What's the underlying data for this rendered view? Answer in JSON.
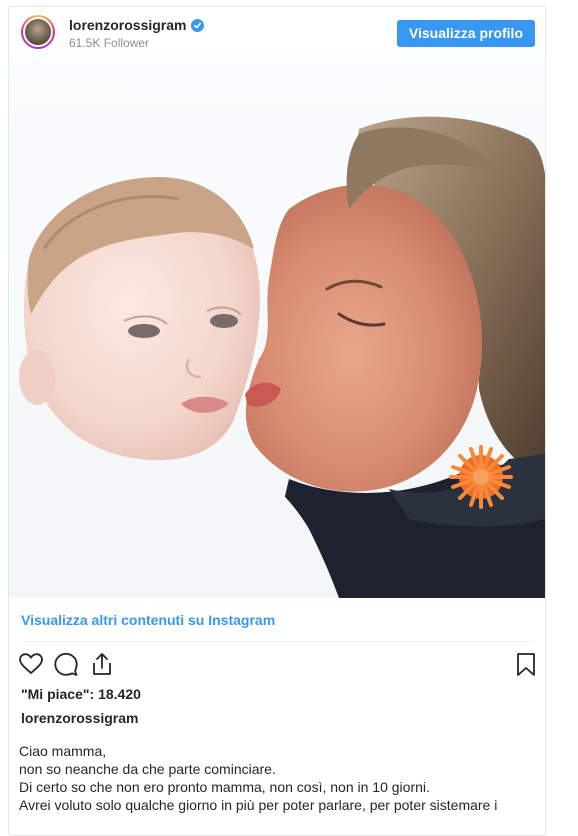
{
  "header": {
    "username": "lorenzorossigram",
    "followers": "61.5K Follower",
    "profile_button": "Visualizza profilo"
  },
  "icons": {
    "verified": "verified-badge-icon",
    "like": "heart-icon",
    "comment": "comment-icon",
    "share": "share-icon",
    "save": "bookmark-icon"
  },
  "colors": {
    "accent": "#3897f0",
    "text": "#262626",
    "muted": "#8e8e8e"
  },
  "more_link": "Visualizza altri contenuti su Instagram",
  "likes": "\"Mi piace\": 18.420",
  "author": "lorenzorossigram",
  "caption": {
    "lines": [
      "Ciao mamma,",
      "non so neanche da che parte cominciare.",
      "Di certo so che non ero pronto mamma, non così, non in 10 giorni.",
      "Avrei voluto solo qualche giorno in più per poter parlare, per poter sistemare i"
    ]
  }
}
